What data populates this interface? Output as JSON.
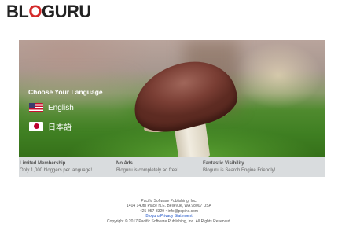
{
  "logo": {
    "part1": "BL",
    "part2": "O",
    "part3": "GURU",
    "note": ""
  },
  "hero": {
    "choose_heading": "Choose Your Language",
    "languages": [
      {
        "label": "English",
        "flag": "us-flag-icon"
      },
      {
        "label": "日本語",
        "flag": "japan-flag-icon"
      }
    ]
  },
  "features": [
    {
      "heading": "Limited Membership",
      "text": "Only 1,000 bloggers per language!"
    },
    {
      "heading": "No Ads",
      "text": "Bloguru is completely ad free!"
    },
    {
      "heading": "Fantastic Visibility",
      "text": "Bloguru is Search Engine Friendly!"
    }
  ],
  "footer": {
    "company": "Pacific Software Publishing, Inc.",
    "address": "1404 140th Place N.E. Bellevue, WA 98007 USA",
    "contact": "425-957-3329 • info@pspinc.com",
    "privacy_link": "Bloguru Privacy Statement",
    "copyright": "Copyright © 2017 Pacific Software Publishing, Inc. All Rights Reserved."
  },
  "colors": {
    "logo_accent": "#d42a2a",
    "link": "#1f55c8",
    "feature_bar": "#d9dcde"
  }
}
